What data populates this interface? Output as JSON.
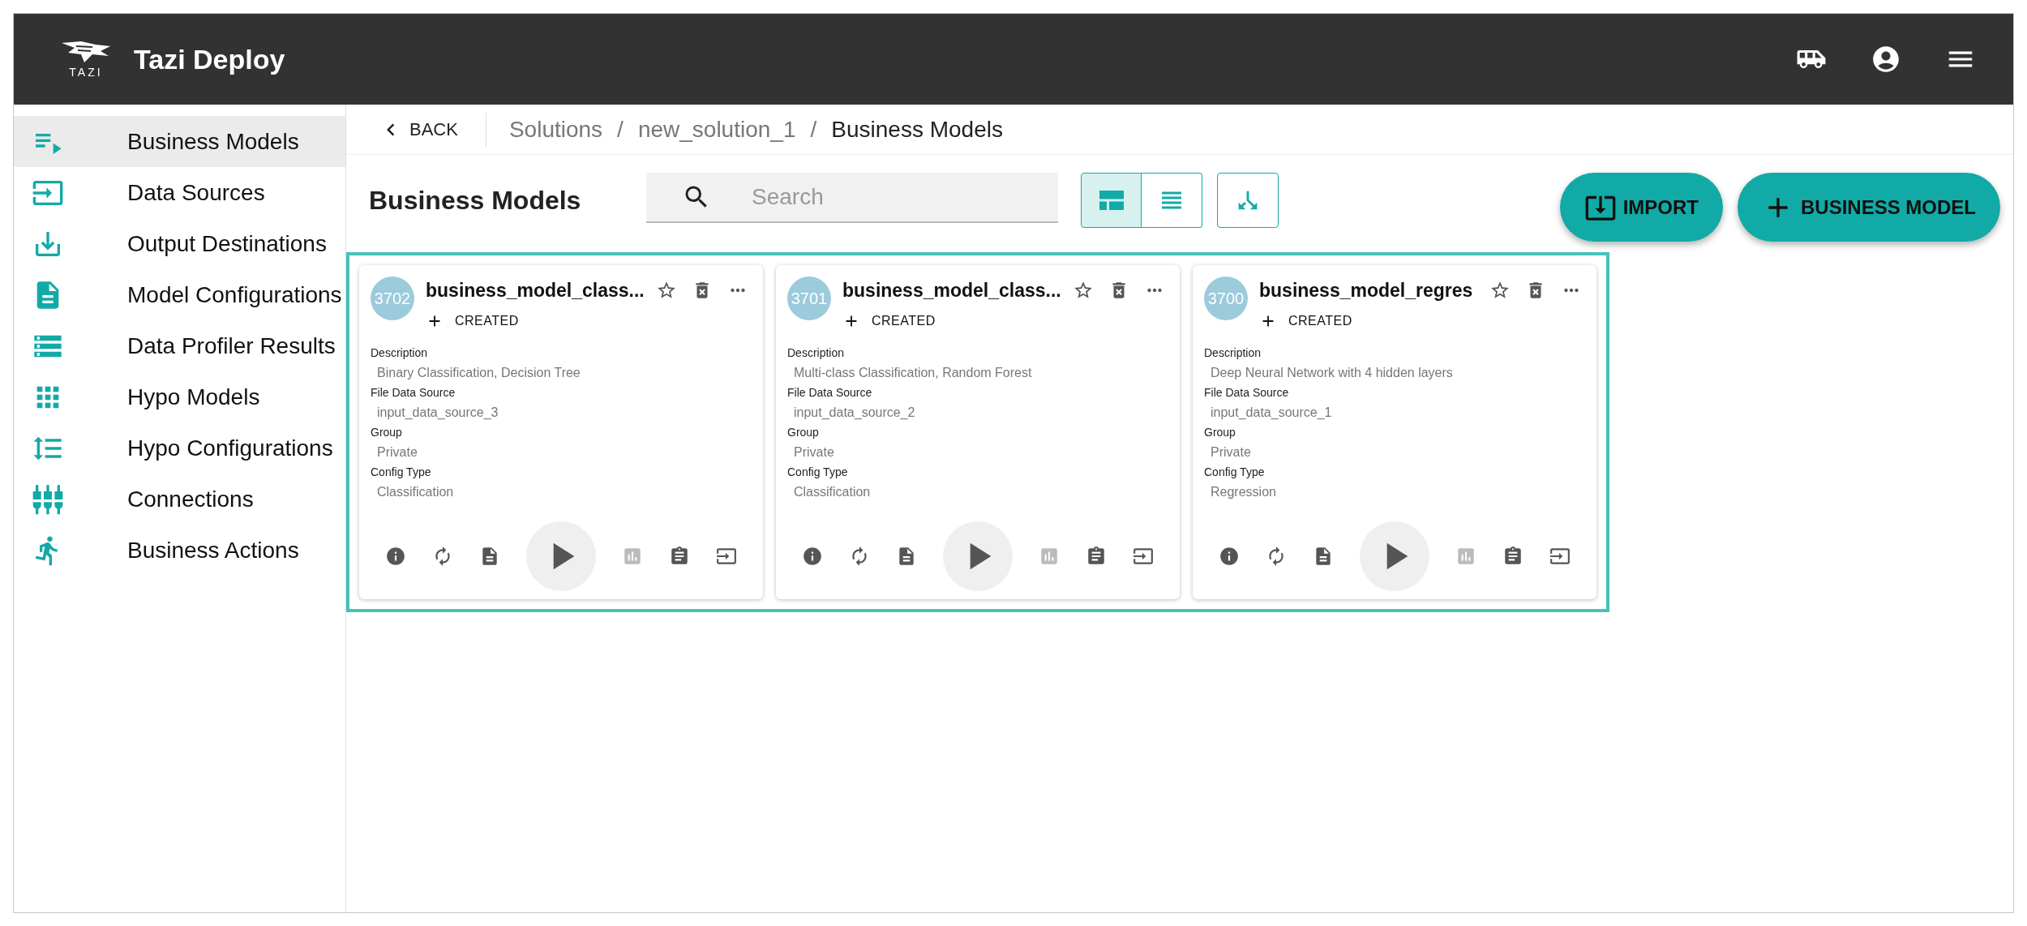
{
  "header": {
    "logo_text": "TAZI",
    "title": "Tazi Deploy"
  },
  "sidebar": {
    "items": [
      {
        "label": "Business Models",
        "kind": "models",
        "selected": true
      },
      {
        "label": "Data Sources",
        "kind": "sources",
        "selected": false
      },
      {
        "label": "Output Destinations",
        "kind": "outputs",
        "selected": false
      },
      {
        "label": "Model Configurations",
        "kind": "configs",
        "selected": false
      },
      {
        "label": "Data Profiler Results",
        "kind": "profiler",
        "selected": false
      },
      {
        "label": "Hypo Models",
        "kind": "hypo",
        "selected": false
      },
      {
        "label": "Hypo Configurations",
        "kind": "hypoconf",
        "selected": false
      },
      {
        "label": "Connections",
        "kind": "connections",
        "selected": false
      },
      {
        "label": "Business Actions",
        "kind": "actions",
        "selected": false
      }
    ]
  },
  "breadcrumb": {
    "back": "BACK",
    "separator": "/",
    "path": [
      "Solutions",
      "new_solution_1",
      "Business Models"
    ]
  },
  "page_title": "Business Models",
  "search": {
    "placeholder": "Search"
  },
  "view_toggle": [
    {
      "kind": "grid",
      "selected": true
    },
    {
      "kind": "list",
      "selected": false
    }
  ],
  "buttons": [
    {
      "kind": "import",
      "label": "IMPORT"
    },
    {
      "kind": "add",
      "label": "BUSINESS MODEL"
    }
  ],
  "cards": [
    {
      "id": "3702",
      "title": "business_model_class...",
      "status": "CREATED",
      "fields": [
        {
          "label": "Description",
          "value": "Binary Classification, Decision Tree"
        },
        {
          "label": "File Data Source",
          "value": "input_data_source_3"
        },
        {
          "label": "Group",
          "value": "Private"
        },
        {
          "label": "Config Type",
          "value": "Classification"
        }
      ],
      "actions": [
        {
          "kind": "info",
          "disabled": false
        },
        {
          "kind": "refresh",
          "disabled": false
        },
        {
          "kind": "doc",
          "disabled": false
        },
        {
          "kind": "play",
          "disabled": false
        },
        {
          "kind": "chart",
          "disabled": true
        },
        {
          "kind": "clipboard",
          "disabled": false
        },
        {
          "kind": "input",
          "disabled": false
        }
      ]
    },
    {
      "id": "3701",
      "title": "business_model_class...",
      "status": "CREATED",
      "fields": [
        {
          "label": "Description",
          "value": "Multi-class Classification, Random Forest"
        },
        {
          "label": "File Data Source",
          "value": "input_data_source_2"
        },
        {
          "label": "Group",
          "value": "Private"
        },
        {
          "label": "Config Type",
          "value": "Classification"
        }
      ],
      "actions": [
        {
          "kind": "info",
          "disabled": false
        },
        {
          "kind": "refresh",
          "disabled": false
        },
        {
          "kind": "doc",
          "disabled": false
        },
        {
          "kind": "play",
          "disabled": false
        },
        {
          "kind": "chart",
          "disabled": true
        },
        {
          "kind": "clipboard",
          "disabled": false
        },
        {
          "kind": "input",
          "disabled": false
        }
      ]
    },
    {
      "id": "3700",
      "title": "business_model_regres",
      "status": "CREATED",
      "fields": [
        {
          "label": "Description",
          "value": "Deep Neural Network with 4 hidden layers"
        },
        {
          "label": "File Data Source",
          "value": "input_data_source_1"
        },
        {
          "label": "Group",
          "value": "Private"
        },
        {
          "label": "Config Type",
          "value": "Regression"
        }
      ],
      "actions": [
        {
          "kind": "info",
          "disabled": false
        },
        {
          "kind": "refresh",
          "disabled": false
        },
        {
          "kind": "doc",
          "disabled": false
        },
        {
          "kind": "play",
          "disabled": false
        },
        {
          "kind": "chart",
          "disabled": true
        },
        {
          "kind": "clipboard",
          "disabled": false
        },
        {
          "kind": "input",
          "disabled": false
        }
      ]
    }
  ]
}
